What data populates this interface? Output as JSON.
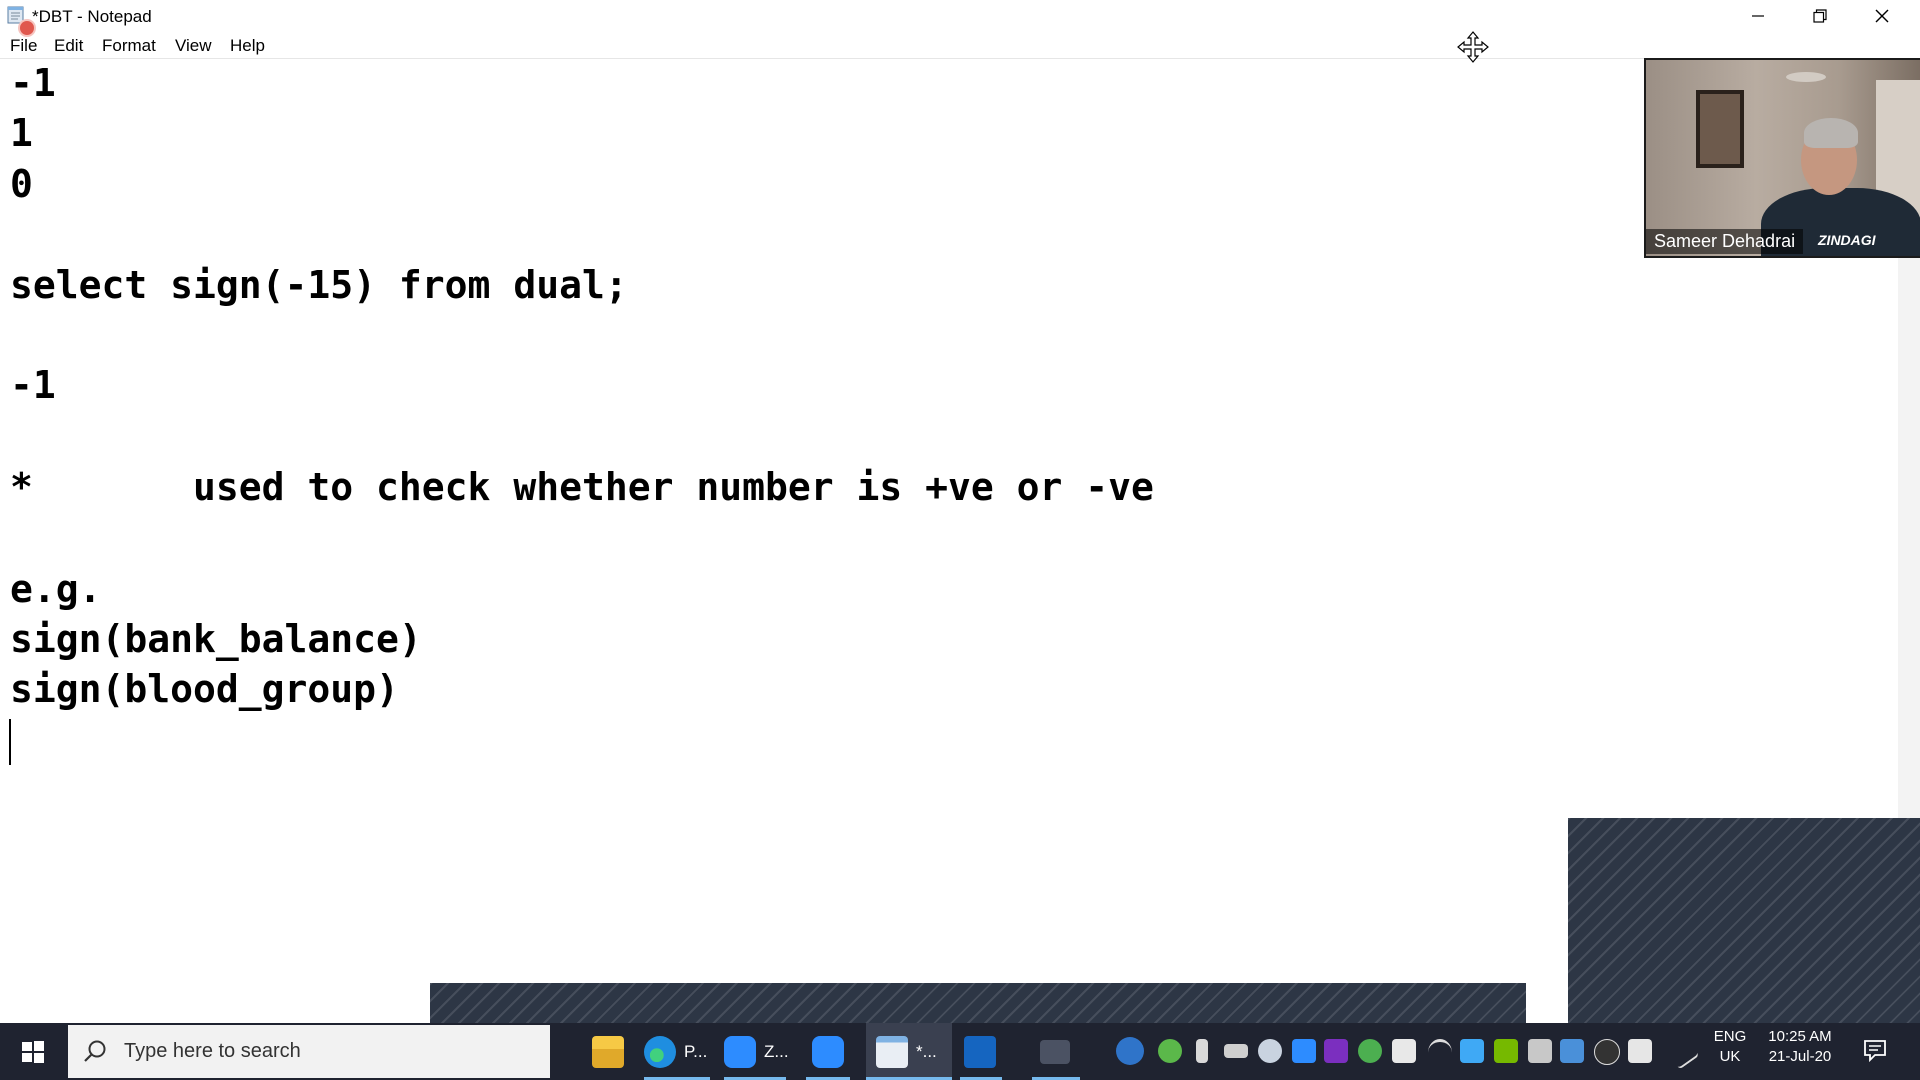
{
  "window": {
    "title": "*DBT - Notepad"
  },
  "menu": {
    "items": [
      "File",
      "Edit",
      "Format",
      "View",
      "Help"
    ]
  },
  "editor": {
    "lines": [
      "-1",
      "1",
      "0",
      "",
      "select sign(-15) from dual;",
      "",
      "-1",
      "",
      "*       used to check whether number is +ve or -ve",
      "",
      "e.g.",
      "sign(bank_balance)",
      "sign(blood_group)"
    ]
  },
  "video": {
    "participant_name": "Sameer Dehadrai",
    "shirt_text": "ZINDAGI"
  },
  "taskbar": {
    "search_placeholder": "Type here to search",
    "apps": [
      {
        "icon": "file-explorer-icon",
        "label": ""
      },
      {
        "icon": "edge-icon",
        "label": "P..."
      },
      {
        "icon": "zoom-icon",
        "label": "Z..."
      },
      {
        "icon": "zoom-meeting-icon",
        "label": ""
      },
      {
        "icon": "notepad-icon",
        "label": "*..."
      },
      {
        "icon": "whiteboard-icon",
        "label": ""
      },
      {
        "icon": "window-icon",
        "label": ""
      }
    ],
    "language": "ENG",
    "region": "UK",
    "time": "10:25 AM",
    "date": "21-Jul-20"
  },
  "colors": {
    "taskbar_bg": "#1f2330",
    "accent": "#76b9ed",
    "hatch": "#2d3645"
  }
}
